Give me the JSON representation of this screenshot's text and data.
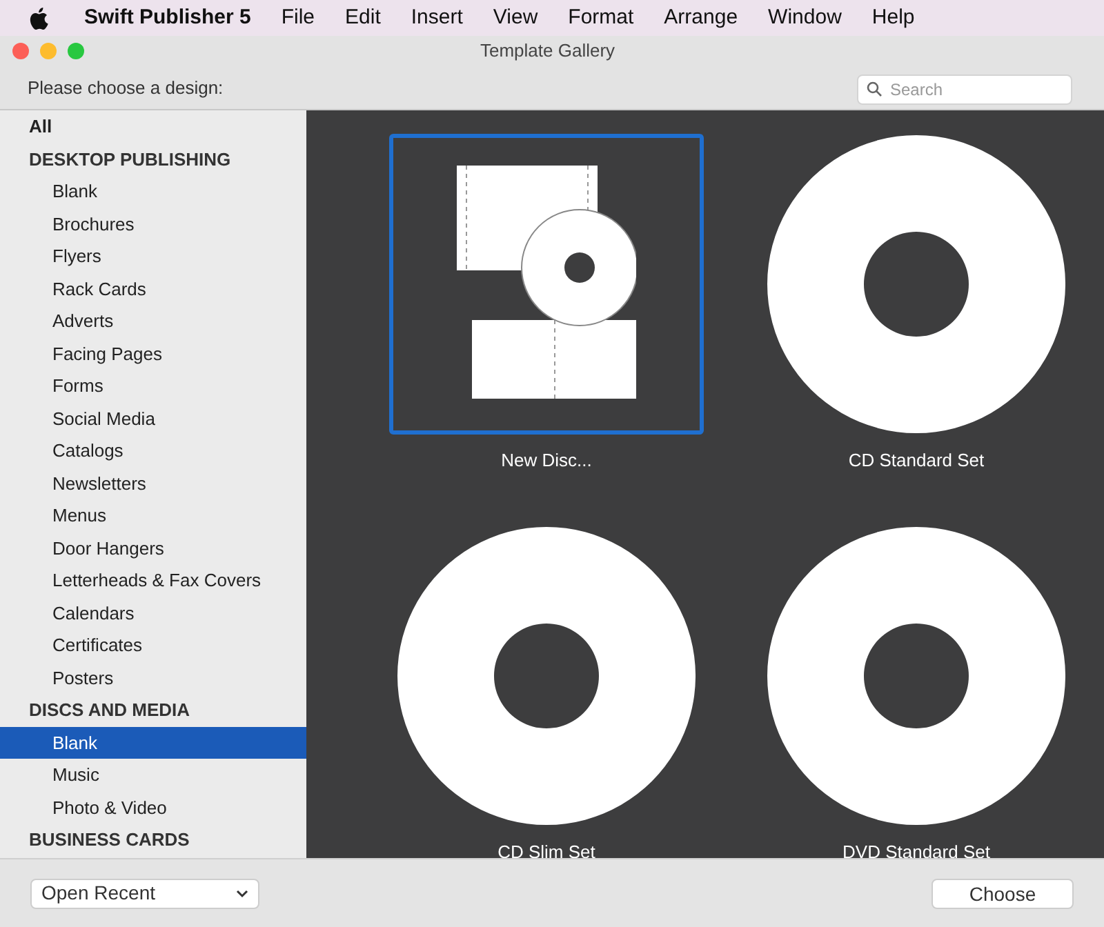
{
  "menu_bar": {
    "app": "Swift Publisher 5",
    "items": [
      "File",
      "Edit",
      "Insert",
      "View",
      "Format",
      "Arrange",
      "Window",
      "Help"
    ]
  },
  "window": {
    "title": "Template Gallery"
  },
  "prompt": "Please choose a design:",
  "search": {
    "placeholder": "Search"
  },
  "sidebar": {
    "items": [
      {
        "label": "All",
        "kind": "top",
        "selected": false
      },
      {
        "label": "DESKTOP PUBLISHING",
        "kind": "header",
        "selected": false
      },
      {
        "label": "Blank",
        "kind": "item",
        "selected": false
      },
      {
        "label": "Brochures",
        "kind": "item",
        "selected": false
      },
      {
        "label": "Flyers",
        "kind": "item",
        "selected": false
      },
      {
        "label": "Rack Cards",
        "kind": "item",
        "selected": false
      },
      {
        "label": "Adverts",
        "kind": "item",
        "selected": false
      },
      {
        "label": "Facing Pages",
        "kind": "item",
        "selected": false
      },
      {
        "label": "Forms",
        "kind": "item",
        "selected": false
      },
      {
        "label": "Social Media",
        "kind": "item",
        "selected": false
      },
      {
        "label": "Catalogs",
        "kind": "item",
        "selected": false
      },
      {
        "label": "Newsletters",
        "kind": "item",
        "selected": false
      },
      {
        "label": "Menus",
        "kind": "item",
        "selected": false
      },
      {
        "label": "Door Hangers",
        "kind": "item",
        "selected": false
      },
      {
        "label": "Letterheads & Fax Covers",
        "kind": "item",
        "selected": false
      },
      {
        "label": "Calendars",
        "kind": "item",
        "selected": false
      },
      {
        "label": "Certificates",
        "kind": "item",
        "selected": false
      },
      {
        "label": "Posters",
        "kind": "item",
        "selected": false
      },
      {
        "label": "DISCS AND MEDIA",
        "kind": "header",
        "selected": false
      },
      {
        "label": "Blank",
        "kind": "item",
        "selected": true
      },
      {
        "label": "Music",
        "kind": "item",
        "selected": false
      },
      {
        "label": "Photo & Video",
        "kind": "item",
        "selected": false
      },
      {
        "label": "BUSINESS CARDS",
        "kind": "header",
        "selected": false
      }
    ]
  },
  "templates": [
    {
      "label": "New Disc...",
      "kind": "new_disc",
      "selected": true
    },
    {
      "label": "CD Standard Set",
      "kind": "disc",
      "selected": false
    },
    {
      "label": "CD Slim Set",
      "kind": "disc",
      "selected": false
    },
    {
      "label": "DVD Standard Set",
      "kind": "disc",
      "selected": false
    }
  ],
  "footer": {
    "recent": "Open Recent",
    "choose": "Choose"
  }
}
